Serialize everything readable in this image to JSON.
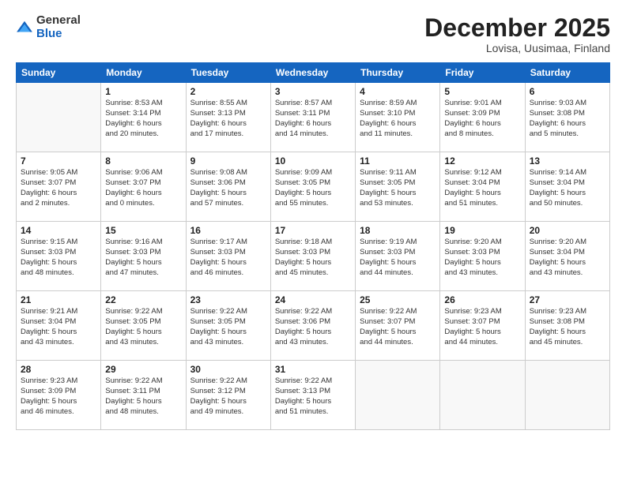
{
  "logo": {
    "general": "General",
    "blue": "Blue"
  },
  "title": "December 2025",
  "location": "Lovisa, Uusimaa, Finland",
  "days_header": [
    "Sunday",
    "Monday",
    "Tuesday",
    "Wednesday",
    "Thursday",
    "Friday",
    "Saturday"
  ],
  "weeks": [
    [
      {
        "day": "",
        "info": ""
      },
      {
        "day": "1",
        "info": "Sunrise: 8:53 AM\nSunset: 3:14 PM\nDaylight: 6 hours\nand 20 minutes."
      },
      {
        "day": "2",
        "info": "Sunrise: 8:55 AM\nSunset: 3:13 PM\nDaylight: 6 hours\nand 17 minutes."
      },
      {
        "day": "3",
        "info": "Sunrise: 8:57 AM\nSunset: 3:11 PM\nDaylight: 6 hours\nand 14 minutes."
      },
      {
        "day": "4",
        "info": "Sunrise: 8:59 AM\nSunset: 3:10 PM\nDaylight: 6 hours\nand 11 minutes."
      },
      {
        "day": "5",
        "info": "Sunrise: 9:01 AM\nSunset: 3:09 PM\nDaylight: 6 hours\nand 8 minutes."
      },
      {
        "day": "6",
        "info": "Sunrise: 9:03 AM\nSunset: 3:08 PM\nDaylight: 6 hours\nand 5 minutes."
      }
    ],
    [
      {
        "day": "7",
        "info": "Sunrise: 9:05 AM\nSunset: 3:07 PM\nDaylight: 6 hours\nand 2 minutes."
      },
      {
        "day": "8",
        "info": "Sunrise: 9:06 AM\nSunset: 3:07 PM\nDaylight: 6 hours\nand 0 minutes."
      },
      {
        "day": "9",
        "info": "Sunrise: 9:08 AM\nSunset: 3:06 PM\nDaylight: 5 hours\nand 57 minutes."
      },
      {
        "day": "10",
        "info": "Sunrise: 9:09 AM\nSunset: 3:05 PM\nDaylight: 5 hours\nand 55 minutes."
      },
      {
        "day": "11",
        "info": "Sunrise: 9:11 AM\nSunset: 3:05 PM\nDaylight: 5 hours\nand 53 minutes."
      },
      {
        "day": "12",
        "info": "Sunrise: 9:12 AM\nSunset: 3:04 PM\nDaylight: 5 hours\nand 51 minutes."
      },
      {
        "day": "13",
        "info": "Sunrise: 9:14 AM\nSunset: 3:04 PM\nDaylight: 5 hours\nand 50 minutes."
      }
    ],
    [
      {
        "day": "14",
        "info": "Sunrise: 9:15 AM\nSunset: 3:03 PM\nDaylight: 5 hours\nand 48 minutes."
      },
      {
        "day": "15",
        "info": "Sunrise: 9:16 AM\nSunset: 3:03 PM\nDaylight: 5 hours\nand 47 minutes."
      },
      {
        "day": "16",
        "info": "Sunrise: 9:17 AM\nSunset: 3:03 PM\nDaylight: 5 hours\nand 46 minutes."
      },
      {
        "day": "17",
        "info": "Sunrise: 9:18 AM\nSunset: 3:03 PM\nDaylight: 5 hours\nand 45 minutes."
      },
      {
        "day": "18",
        "info": "Sunrise: 9:19 AM\nSunset: 3:03 PM\nDaylight: 5 hours\nand 44 minutes."
      },
      {
        "day": "19",
        "info": "Sunrise: 9:20 AM\nSunset: 3:03 PM\nDaylight: 5 hours\nand 43 minutes."
      },
      {
        "day": "20",
        "info": "Sunrise: 9:20 AM\nSunset: 3:04 PM\nDaylight: 5 hours\nand 43 minutes."
      }
    ],
    [
      {
        "day": "21",
        "info": "Sunrise: 9:21 AM\nSunset: 3:04 PM\nDaylight: 5 hours\nand 43 minutes."
      },
      {
        "day": "22",
        "info": "Sunrise: 9:22 AM\nSunset: 3:05 PM\nDaylight: 5 hours\nand 43 minutes."
      },
      {
        "day": "23",
        "info": "Sunrise: 9:22 AM\nSunset: 3:05 PM\nDaylight: 5 hours\nand 43 minutes."
      },
      {
        "day": "24",
        "info": "Sunrise: 9:22 AM\nSunset: 3:06 PM\nDaylight: 5 hours\nand 43 minutes."
      },
      {
        "day": "25",
        "info": "Sunrise: 9:22 AM\nSunset: 3:07 PM\nDaylight: 5 hours\nand 44 minutes."
      },
      {
        "day": "26",
        "info": "Sunrise: 9:23 AM\nSunset: 3:07 PM\nDaylight: 5 hours\nand 44 minutes."
      },
      {
        "day": "27",
        "info": "Sunrise: 9:23 AM\nSunset: 3:08 PM\nDaylight: 5 hours\nand 45 minutes."
      }
    ],
    [
      {
        "day": "28",
        "info": "Sunrise: 9:23 AM\nSunset: 3:09 PM\nDaylight: 5 hours\nand 46 minutes."
      },
      {
        "day": "29",
        "info": "Sunrise: 9:22 AM\nSunset: 3:11 PM\nDaylight: 5 hours\nand 48 minutes."
      },
      {
        "day": "30",
        "info": "Sunrise: 9:22 AM\nSunset: 3:12 PM\nDaylight: 5 hours\nand 49 minutes."
      },
      {
        "day": "31",
        "info": "Sunrise: 9:22 AM\nSunset: 3:13 PM\nDaylight: 5 hours\nand 51 minutes."
      },
      {
        "day": "",
        "info": ""
      },
      {
        "day": "",
        "info": ""
      },
      {
        "day": "",
        "info": ""
      }
    ]
  ]
}
